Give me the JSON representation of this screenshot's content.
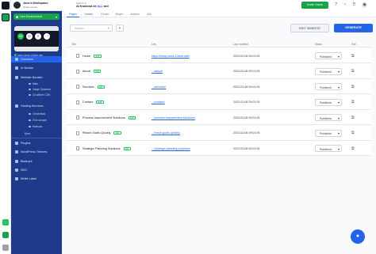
{
  "workspace": {
    "name": "Juno's Workspace",
    "subtitle": "Studio Owner"
  },
  "environment": {
    "label": "Live Environment"
  },
  "site_url": "funny-stork.10web.site",
  "nav": {
    "overview": "Overview",
    "ai_builder": "AI Builder",
    "website_booster": "Website Booster",
    "sub_booster": [
      "Main",
      "Image Optimizer",
      "Cloudflare CDN"
    ],
    "hosting": "Hosting Services",
    "sub_hosting": [
      "Credentials",
      "Free domain",
      "Backups"
    ],
    "more": "More",
    "plugins": "Plugins",
    "themes": "WordPress Themes",
    "backups": "Backups",
    "seo": "SEO",
    "white_label": "White Label"
  },
  "header": {
    "crumb": "Search ai",
    "title": "AI frontend dashboard",
    "beta": "Beta",
    "invite": "Invite Users"
  },
  "tabs": [
    "Pages",
    "Header",
    "Footer",
    "Single",
    "Archive",
    "404"
  ],
  "toolbar": {
    "search_placeholder": "Search...",
    "edit": "EDIT WEBSITE",
    "generate": "GENERATE"
  },
  "columns": {
    "title": "Title",
    "link": "Link",
    "modified": "Last modified",
    "status": "Status",
    "edit": "Edit"
  },
  "edit_badge": "Edit",
  "rows": [
    {
      "title": "Home",
      "link": "https://funny-stork.10web.site/",
      "modified": "2023-03-06 09:01:05",
      "status": "Published"
    },
    {
      "title": "About",
      "link": ".../about/",
      "modified": "2023-03-06 09:01:05",
      "status": "Published"
    },
    {
      "title": "Services",
      "link": ".../services/",
      "modified": "2023-03-06 09:01:05",
      "status": "Published"
    },
    {
      "title": "Contact",
      "link": ".../contact/",
      "modified": "2023-03-06 09:01:05",
      "status": "Published"
    },
    {
      "title": "Process Improvement Solutions",
      "link": ".../process-improvement-solutions/",
      "modified": "2023-03-06 09:01:05",
      "status": "Published"
    },
    {
      "title": "Reach Goals Quickly",
      "link": ".../reach-goals-quickly/",
      "modified": "2023-03-06 09:01:05",
      "status": "Published"
    },
    {
      "title": "Strategic Planning Solutions",
      "link": ".../strategic-planning-solutions/",
      "modified": "2023-03-06 09:01:05",
      "status": "Published"
    }
  ],
  "colors": {
    "sidebar": "#1e3a8a",
    "accent": "#2563eb",
    "live": "#16a34a"
  }
}
